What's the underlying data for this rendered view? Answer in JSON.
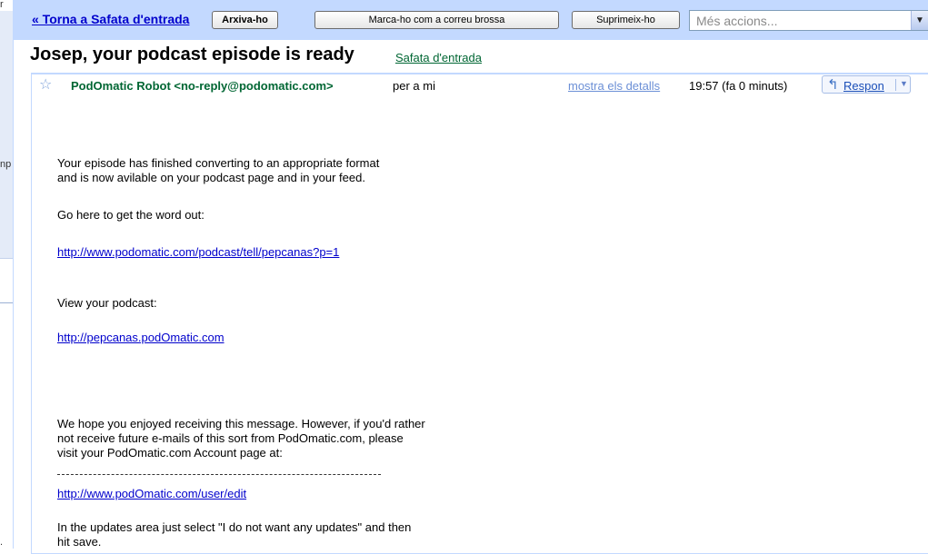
{
  "left_fragment": {
    "top_char": "r",
    "mid_text": "np",
    "bottom_char": "."
  },
  "toolbar": {
    "back_link": "« Torna a Safata d'entrada",
    "archive_label": "Arxiva-ho",
    "spam_label": "Marca-ho com a correu brossa",
    "delete_label": "Suprimeix-ho",
    "more_actions_placeholder": "Més accions...",
    "dropdown_glyph": "▼"
  },
  "conversation": {
    "subject": "Josep, your podcast episode is ready",
    "label": "Safata d'entrada"
  },
  "message": {
    "star_glyph": "☆",
    "sender": "PodOmatic Robot <no-reply@podomatic.com>",
    "recipient": "per a mi",
    "show_details": "mostra els detalls",
    "time": "19:57 (fa 0 minuts)",
    "reply_label": "Respon",
    "reply_arrow": "↰",
    "reply_dropdown": "▼",
    "paragraph1": "Your episode has finished converting to an appropriate format\nand is now avilable on your podcast page and in your feed.",
    "paragraph2": "Go here to get the word out:",
    "link1": "http://www.podomatic.com/podcast/tell/pepcanas?p=1",
    "paragraph3": "View your podcast:",
    "link2": "http://pepcanas.podOmatic.com",
    "footer_paragraph": "We hope you enjoyed receiving this message. However, if you'd rather\nnot receive future e-mails of this sort from PodOmatic.com, please\nvisit your PodOmatic.com Account page at:",
    "link3": "http://www.podOmatic.com/user/edit",
    "closing_paragraph": "In the updates area just select \"I do not want any updates\" and then\nhit save."
  }
}
